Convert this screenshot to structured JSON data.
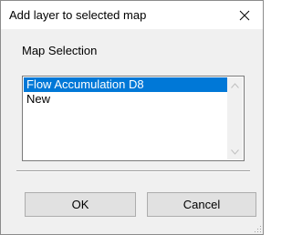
{
  "window": {
    "title": "Add layer to selected map",
    "close_icon": "close-icon"
  },
  "main": {
    "section_label": "Map Selection",
    "map_list": {
      "items": [
        {
          "label": "Flow Accumulation D8",
          "selected": true
        },
        {
          "label": "New",
          "selected": false
        }
      ]
    }
  },
  "buttons": {
    "ok_label": "OK",
    "cancel_label": "Cancel"
  },
  "colors": {
    "selection": "#0078d7",
    "dialog_background": "#f0f0f0",
    "button_face": "#e1e1e1"
  }
}
